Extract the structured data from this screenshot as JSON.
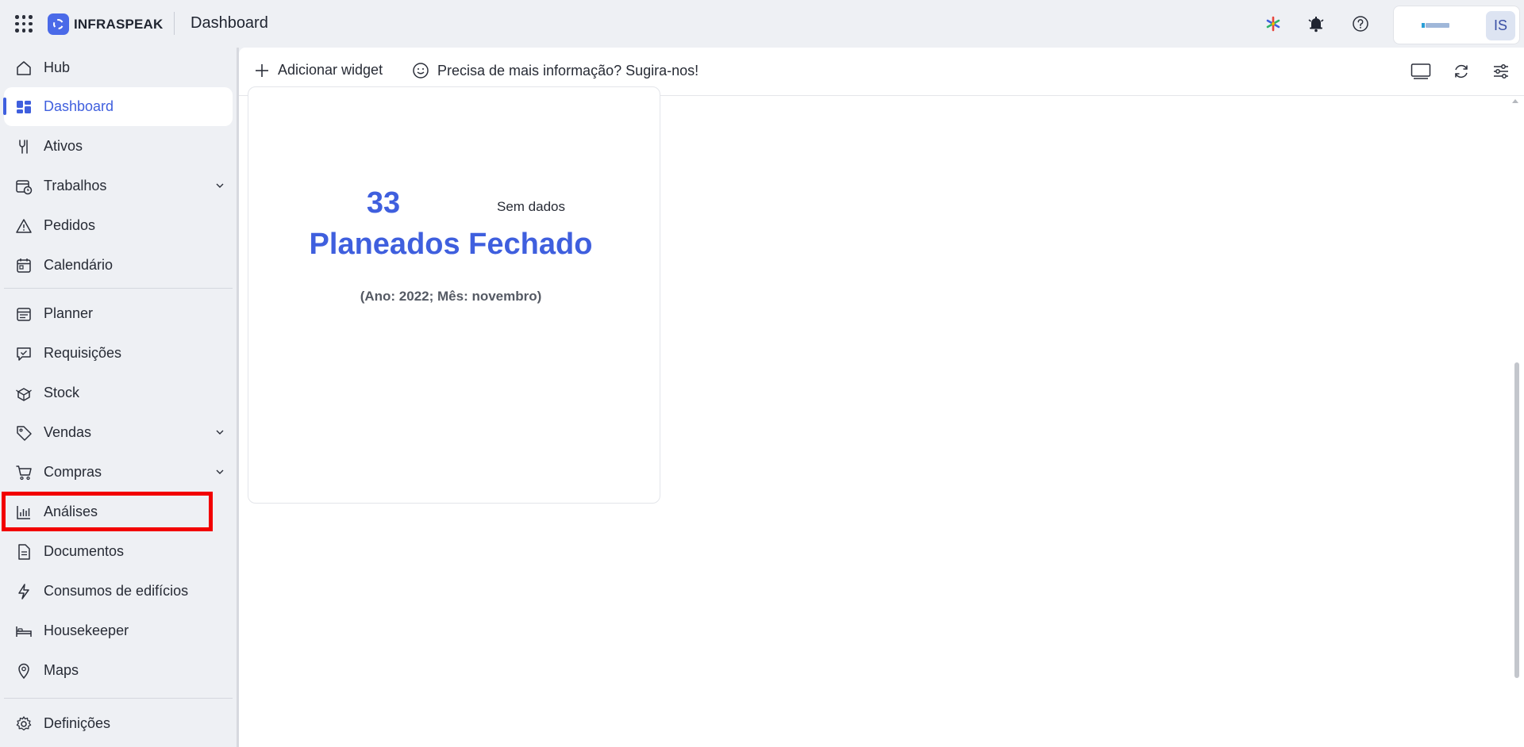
{
  "header": {
    "brand": "INFRASPEAK",
    "page_title": "Dashboard",
    "avatar_initials": "IS",
    "icons": [
      "apps-grid-icon",
      "sparkle-icon",
      "bell-icon",
      "help-icon"
    ]
  },
  "sidebar": {
    "items": [
      {
        "label": "Hub",
        "icon": "home-icon"
      },
      {
        "label": "Dashboard",
        "icon": "dashboard-icon",
        "active": true
      },
      {
        "label": "Ativos",
        "icon": "asset-icon"
      },
      {
        "label": "Trabalhos",
        "icon": "calendar-clock-icon",
        "expandable": true
      },
      {
        "label": "Pedidos",
        "icon": "warning-icon"
      },
      {
        "label": "Calendário",
        "icon": "calendar-icon"
      },
      {
        "label": "Planner",
        "icon": "planner-icon"
      },
      {
        "label": "Requisições",
        "icon": "chat-check-icon"
      },
      {
        "label": "Stock",
        "icon": "box-icon"
      },
      {
        "label": "Vendas",
        "icon": "tag-icon",
        "expandable": true
      },
      {
        "label": "Compras",
        "icon": "cart-icon",
        "expandable": true
      },
      {
        "label": "Análises",
        "icon": "bar-chart-icon",
        "highlighted": true
      },
      {
        "label": "Documentos",
        "icon": "document-icon"
      },
      {
        "label": "Consumos de edifícios",
        "icon": "lightning-icon"
      },
      {
        "label": "Housekeeper",
        "icon": "bed-icon"
      },
      {
        "label": "Maps",
        "icon": "map-pin-icon"
      },
      {
        "label": "Definições",
        "icon": "gear-icon"
      }
    ]
  },
  "toolbar": {
    "add_widget": "Adicionar widget",
    "feedback": "Precisa de mais informação? Sugira-nos!",
    "right_icons": [
      "monitor-icon",
      "refresh-icon",
      "sliders-icon"
    ]
  },
  "widget": {
    "value": "33",
    "label": "Planeados Fechado",
    "no_data": "Sem dados",
    "period": "(Ano: 2022; Mês: novembro)"
  },
  "colors": {
    "accent": "#3f5fde",
    "highlight": "#f20000",
    "background": "#eef0f4"
  }
}
